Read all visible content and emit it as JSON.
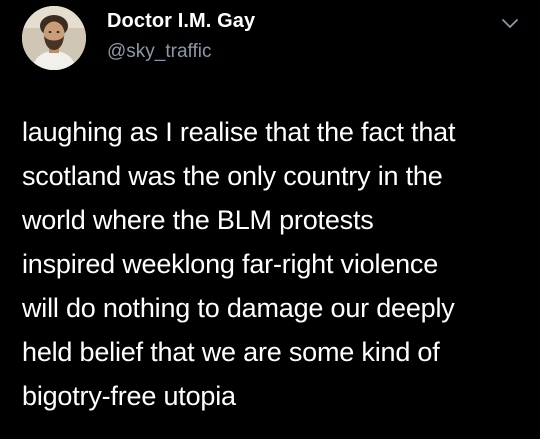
{
  "tweet": {
    "author": {
      "display_name": "Doctor I.M. Gay",
      "handle": "@sky_traffic",
      "avatar": "profile-photo"
    },
    "menu_icon": "chevron-down-icon",
    "text_lines": [
      "laughing as I realise that the fact that",
      "scotland was the only country in the",
      "world where the BLM protests",
      "inspired weeklong far-right violence",
      "will do nothing to damage our deeply",
      "held belief that we are some kind of",
      "bigotry-free utopia"
    ]
  },
  "colors": {
    "background": "#000000",
    "text": "#ffffff",
    "secondary_text": "#8b98a5"
  }
}
